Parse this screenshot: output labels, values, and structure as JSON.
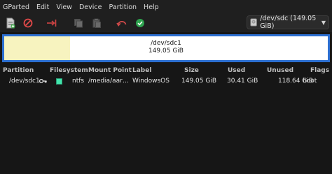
{
  "menubar": {
    "items": [
      "GParted",
      "Edit",
      "View",
      "Device",
      "Partition",
      "Help"
    ]
  },
  "toolbar": {
    "buttons": [
      {
        "icon": "new-partition-icon",
        "enabled": true
      },
      {
        "icon": "delete-icon",
        "enabled": true
      },
      {
        "icon": "resize-move-icon",
        "enabled": true
      },
      {
        "icon": "copy-icon",
        "enabled": false
      },
      {
        "icon": "paste-icon",
        "enabled": false
      },
      {
        "icon": "undo-icon",
        "enabled": true
      },
      {
        "icon": "apply-icon",
        "enabled": true
      }
    ]
  },
  "device_select": {
    "value": "/dev/sdc (149.05 GiB)",
    "icon": "disk-icon"
  },
  "partition_map": {
    "name": "/dev/sdc1",
    "size": "149.05 GiB",
    "used_fraction": 0.204,
    "border_color": "#2c6fd1",
    "used_color": "#f7f3bf"
  },
  "table": {
    "columns": [
      "Partition",
      "Filesystem",
      "Mount Point",
      "Label",
      "Size",
      "Used",
      "Unused",
      "Flags"
    ],
    "rows": [
      {
        "partition": "/dev/sdc1",
        "filesystem": "ntfs",
        "filesystem_color": "#42e5ac",
        "mount_point": "/media/aar…",
        "label": "WindowsOS",
        "size": "149.05 GiB",
        "used": "30.41 GiB",
        "unused": "118.64 GiB",
        "flags": "boot"
      }
    ]
  }
}
